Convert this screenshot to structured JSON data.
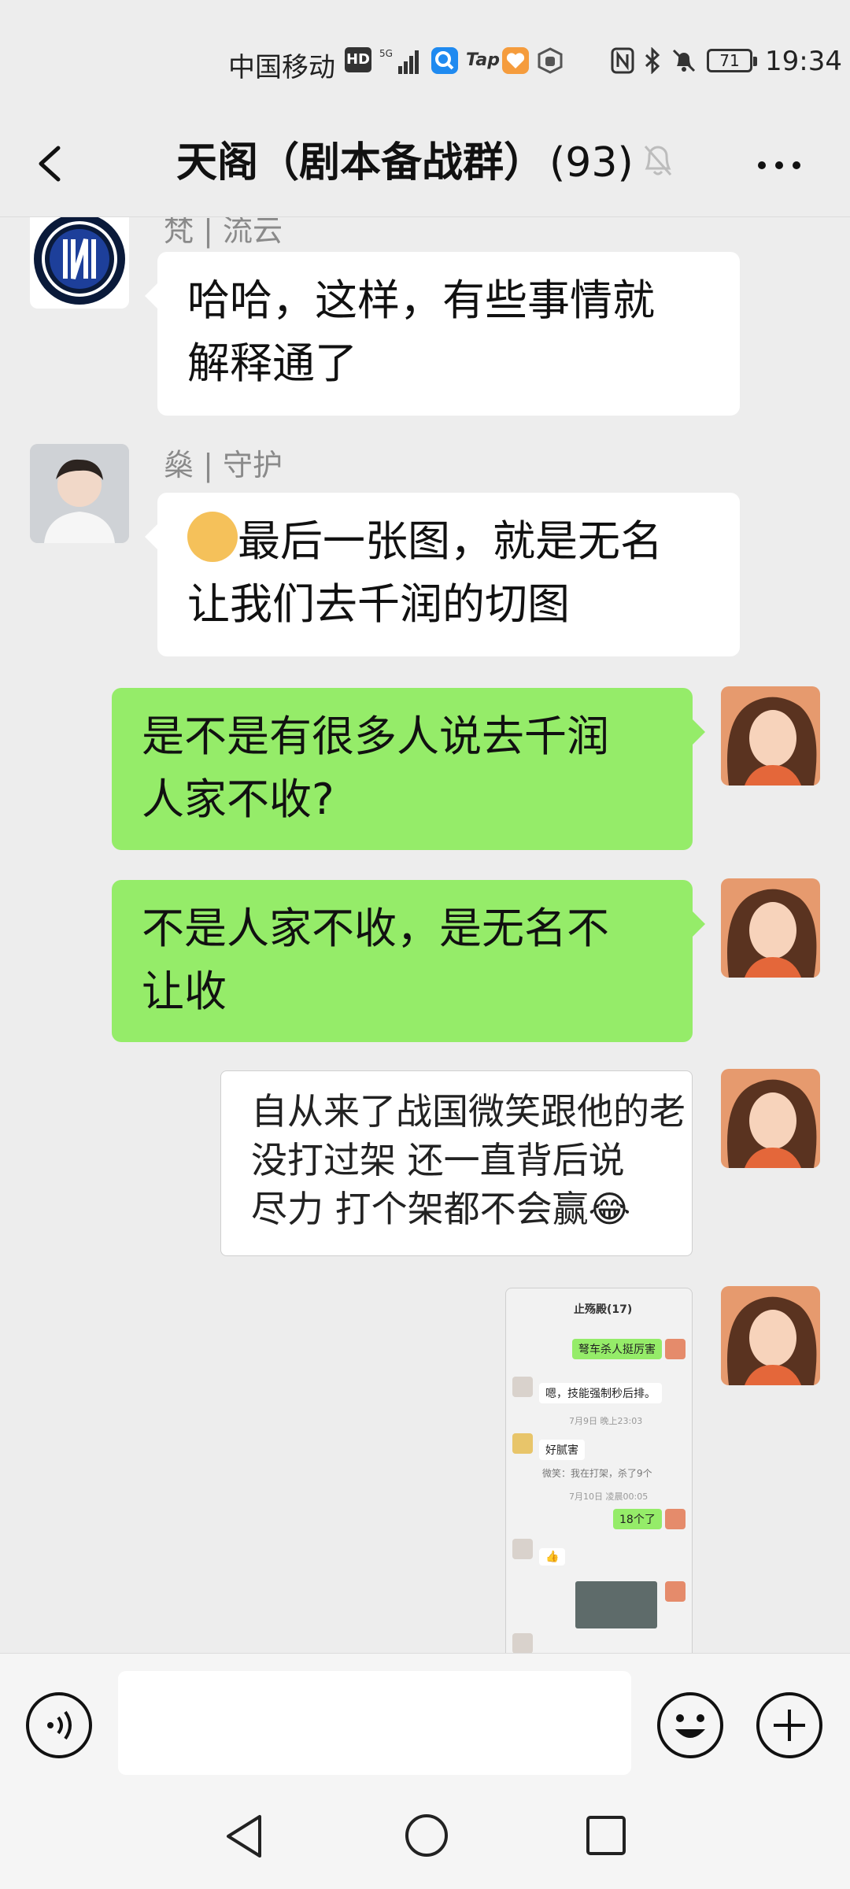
{
  "status_bar": {
    "carrier": "中国移动",
    "hd_label": "HD",
    "tap_label": "Tap",
    "battery": "71",
    "time": "19:34"
  },
  "header": {
    "title": "天阁（剧本备战群）",
    "member_count": "(93)"
  },
  "messages": [
    {
      "sender": "梵 | 流云",
      "side": "in",
      "lines": [
        "哈哈，这样，有些事情就",
        "解释通了"
      ]
    },
    {
      "sender": "燊 | 守护",
      "side": "in",
      "lines": [
        "最后一张图，就是无名",
        "让我们去千润的切图"
      ]
    },
    {
      "sender": "",
      "side": "out",
      "lines": [
        "是不是有很多人说去千润",
        "人家不收?"
      ]
    },
    {
      "sender": "",
      "side": "out",
      "lines": [
        "不是人家不收，是无名不",
        "让收"
      ]
    }
  ],
  "image_text_message": {
    "lines": [
      "自从来了战国微笑跟他的老",
      "没打过架      还一直背后说",
      "尽力  打个架都不会赢😂"
    ]
  },
  "screenshot_message": {
    "title": "止殇殿(17)",
    "items": [
      "弩车杀人挺厉害",
      "嗯，技能强制秒后排。",
      "好腻害",
      "微笑：我在打架，杀了9个",
      "18个了",
      "👍"
    ],
    "times": [
      "7月9日 晚上23:03",
      "7月10日 凌晨00:05"
    ]
  },
  "input_bar": {
    "placeholder": ""
  },
  "colors": {
    "background": "#ededed",
    "outgoing_bubble": "#95ec69",
    "incoming_bubble": "#ffffff"
  }
}
